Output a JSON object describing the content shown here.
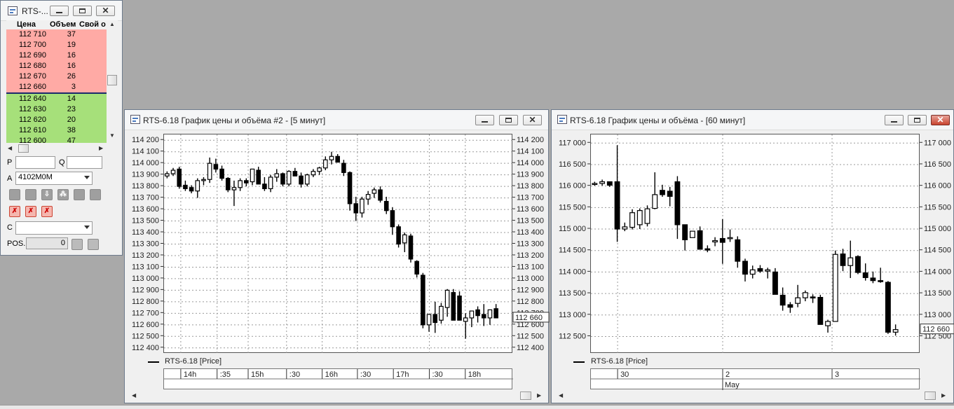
{
  "orderbook": {
    "title": "RTS-...",
    "columns": [
      "Цена",
      "Объем",
      "Свой о"
    ],
    "asks": [
      {
        "price": "112 710",
        "vol": "37"
      },
      {
        "price": "112 700",
        "vol": "19"
      },
      {
        "price": "112 690",
        "vol": "16"
      },
      {
        "price": "112 680",
        "vol": "16"
      },
      {
        "price": "112 670",
        "vol": "26"
      },
      {
        "price": "112 660",
        "vol": "3"
      }
    ],
    "bids": [
      {
        "price": "112 640",
        "vol": "14"
      },
      {
        "price": "112 630",
        "vol": "23"
      },
      {
        "price": "112 620",
        "vol": "20"
      },
      {
        "price": "112 610",
        "vol": "38"
      },
      {
        "price": "112 600",
        "vol": "47"
      }
    ],
    "p_label": "P",
    "q_label": "Q",
    "a_label": "A",
    "account": "4102M0M",
    "c_label": "C",
    "pos_label": "POS.",
    "pos_value": "0",
    "colors": {
      "ask": "#ffaaa5",
      "bid": "#a6e07a"
    }
  },
  "chart5": {
    "title": "RTS-6.18 График цены и объёма #2 - [5 минут]",
    "legend": "RTS-6.18 [Price]",
    "last_price": "112 660",
    "chart_data": {
      "type": "candlestick",
      "interval": "5 минут",
      "y_ticks": [
        114200,
        114100,
        114000,
        113900,
        113800,
        113700,
        113600,
        113500,
        113400,
        113300,
        113200,
        113100,
        113000,
        112900,
        112800,
        112700,
        112600,
        112500,
        112400
      ],
      "y_tick_labels": [
        "114 200",
        "114 100",
        "114 000",
        "113 900",
        "113 800",
        "113 700",
        "113 600",
        "113 500",
        "113 400",
        "113 300",
        "113 200",
        "113 100",
        "113 000",
        "112 900",
        "112 800",
        "112 700",
        "112 600",
        "112 500",
        "112 400"
      ],
      "ylim": [
        112350,
        114250
      ],
      "x_labels": [
        "14h",
        ":35",
        "15h",
        ":30",
        "16h",
        ":30",
        "17h",
        ":30",
        "18h"
      ],
      "last_price": 112660,
      "candles": [
        [
          113890,
          113930,
          113870,
          113910
        ],
        [
          113910,
          113960,
          113890,
          113940
        ],
        [
          113950,
          113970,
          113780,
          113800
        ],
        [
          113810,
          113850,
          113760,
          113780
        ],
        [
          113790,
          113810,
          113740,
          113760
        ],
        [
          113760,
          113870,
          113700,
          113850
        ],
        [
          113850,
          113880,
          113810,
          113860
        ],
        [
          113860,
          114050,
          113830,
          114000
        ],
        [
          113990,
          114040,
          113920,
          113950
        ],
        [
          113950,
          113980,
          113850,
          113870
        ],
        [
          113870,
          113880,
          113750,
          113770
        ],
        [
          113770,
          113850,
          113630,
          113790
        ],
        [
          113790,
          113870,
          113760,
          113850
        ],
        [
          113850,
          113870,
          113800,
          113830
        ],
        [
          113840,
          113920,
          113810,
          113950
        ],
        [
          113940,
          113970,
          113830,
          113820
        ],
        [
          113820,
          113880,
          113760,
          113780
        ],
        [
          113780,
          113900,
          113750,
          113880
        ],
        [
          113880,
          113950,
          113840,
          113910
        ],
        [
          113910,
          113920,
          113800,
          113820
        ],
        [
          113820,
          113940,
          113800,
          113930
        ],
        [
          113930,
          113960,
          113900,
          113890
        ],
        [
          113890,
          113920,
          113790,
          113820
        ],
        [
          113820,
          113910,
          113800,
          113900
        ],
        [
          113900,
          113950,
          113880,
          113930
        ],
        [
          113930,
          113970,
          113900,
          113960
        ],
        [
          113960,
          114060,
          113940,
          114030
        ],
        [
          114030,
          114100,
          113990,
          114060
        ],
        [
          114060,
          114080,
          114020,
          114010
        ],
        [
          114000,
          114030,
          113890,
          113920
        ],
        [
          113920,
          113930,
          113590,
          113650
        ],
        [
          113650,
          113710,
          113500,
          113570
        ],
        [
          113570,
          113710,
          113530,
          113690
        ],
        [
          113690,
          113760,
          113640,
          113730
        ],
        [
          113740,
          113790,
          113700,
          113770
        ],
        [
          113770,
          113800,
          113660,
          113680
        ],
        [
          113670,
          113710,
          113560,
          113590
        ],
        [
          113590,
          113620,
          113380,
          113450
        ],
        [
          113450,
          113470,
          113270,
          113300
        ],
        [
          113310,
          113400,
          113230,
          113380
        ],
        [
          113370,
          113390,
          113140,
          113170
        ],
        [
          113150,
          113160,
          113010,
          113040
        ],
        [
          113030,
          113050,
          112570,
          112600
        ],
        [
          112600,
          112670,
          112540,
          112690
        ],
        [
          112690,
          112800,
          112530,
          112620
        ],
        [
          112640,
          112790,
          112610,
          112760
        ],
        [
          112750,
          112910,
          112670,
          112900
        ],
        [
          112880,
          112910,
          112650,
          112640
        ],
        [
          112850,
          112890,
          112690,
          112640
        ],
        [
          112630,
          112700,
          112480,
          112660
        ],
        [
          112660,
          112710,
          112580,
          112720
        ],
        [
          112730,
          112760,
          112620,
          112680
        ],
        [
          112690,
          112780,
          112590,
          112660
        ],
        [
          112660,
          112730,
          112600,
          112730
        ],
        [
          112740,
          112780,
          112690,
          112660
        ]
      ]
    }
  },
  "chart60": {
    "title": "RTS-6.18 График цены и объёма - [60 минут]",
    "legend": "RTS-6.18 [Price]",
    "last_price": "112 660",
    "chart_data": {
      "type": "candlestick",
      "interval": "60 минут",
      "y_ticks": [
        117000,
        116500,
        116000,
        115500,
        115000,
        114500,
        114000,
        113500,
        113000,
        112500
      ],
      "y_tick_labels": [
        "117 000",
        "116 500",
        "116 000",
        "115 500",
        "115 000",
        "114 500",
        "114 000",
        "113 500",
        "113 000",
        "112 500"
      ],
      "ylim": [
        112100,
        117200
      ],
      "x_labels": [
        "30",
        "2",
        "3"
      ],
      "x_labels_row2": [
        "May"
      ],
      "last_price": 112660,
      "candles": [
        [
          116050,
          116100,
          116010,
          116060
        ],
        [
          116060,
          116150,
          116010,
          116100
        ],
        [
          116100,
          116100,
          115980,
          116020
        ],
        [
          116100,
          116950,
          114700,
          115000
        ],
        [
          115000,
          115150,
          114950,
          115050
        ],
        [
          115040,
          115460,
          114990,
          115380
        ],
        [
          115100,
          115480,
          115000,
          115430
        ],
        [
          115130,
          115550,
          115060,
          115470
        ],
        [
          115480,
          116320,
          115460,
          115800
        ],
        [
          115900,
          116030,
          115750,
          115800
        ],
        [
          115880,
          115980,
          115530,
          115760
        ],
        [
          116100,
          116230,
          114770,
          115100
        ],
        [
          115100,
          115000,
          114500,
          114750
        ],
        [
          114800,
          114950,
          114800,
          114950
        ],
        [
          114960,
          115060,
          114780,
          114530
        ],
        [
          114540,
          114620,
          114460,
          114510
        ],
        [
          114700,
          114810,
          114600,
          114730
        ],
        [
          114780,
          115230,
          114190,
          114690
        ],
        [
          114780,
          114990,
          114700,
          114800
        ],
        [
          114750,
          114830,
          114100,
          114250
        ],
        [
          114250,
          114310,
          113780,
          113950
        ],
        [
          113950,
          114150,
          113850,
          114050
        ],
        [
          114080,
          114160,
          113980,
          114020
        ],
        [
          114020,
          114100,
          113850,
          114050
        ],
        [
          114000,
          114090,
          113600,
          113480
        ],
        [
          113460,
          113640,
          113100,
          113230
        ],
        [
          113240,
          113300,
          113050,
          113180
        ],
        [
          113270,
          113700,
          113180,
          113400
        ],
        [
          113400,
          113570,
          113320,
          113520
        ],
        [
          113420,
          113480,
          113280,
          113410
        ],
        [
          113410,
          113470,
          112850,
          112780
        ],
        [
          112750,
          112890,
          112590,
          112850
        ],
        [
          112850,
          114500,
          112850,
          114410
        ],
        [
          114420,
          114540,
          114020,
          114150
        ],
        [
          114150,
          114730,
          113860,
          114330
        ],
        [
          114360,
          114390,
          113950,
          113990
        ],
        [
          113980,
          114200,
          113800,
          113870
        ],
        [
          113860,
          114010,
          113740,
          113800
        ],
        [
          113800,
          114100,
          113750,
          113780
        ],
        [
          113760,
          113790,
          112560,
          112600
        ],
        [
          112600,
          112780,
          112520,
          112660
        ]
      ]
    }
  }
}
